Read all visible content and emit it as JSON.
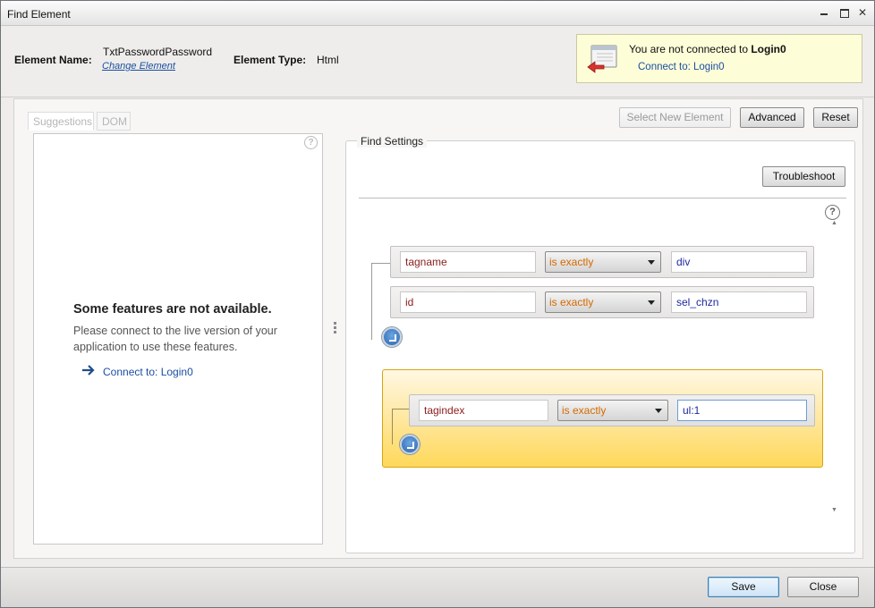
{
  "window": {
    "title": "Find Element"
  },
  "header": {
    "element_name_label": "Element Name:",
    "element_name_value": "TxtPasswordPassword",
    "change_element_link": "Change Element",
    "element_type_label": "Element Type:",
    "element_type_value": "Html"
  },
  "notice": {
    "message_prefix": "You are not connected to",
    "message_target": "Login0",
    "connect_link": "Connect to: Login0"
  },
  "left_panel": {
    "tabs": [
      "Suggestions",
      "DOM"
    ],
    "help": "?",
    "unavailable_title": "Some features are not available.",
    "unavailable_body": "Please connect to the live version of your application to use these features.",
    "connect_link": "Connect to: Login0"
  },
  "toolbar": {
    "select_new_element": "Select New Element",
    "advanced": "Advanced",
    "reset": "Reset"
  },
  "find_settings": {
    "legend": "Find Settings",
    "troubleshoot": "Troubleshoot",
    "help": "?",
    "rows": [
      {
        "attribute": "tagname",
        "operator": "is exactly",
        "value": "div"
      },
      {
        "attribute": "id",
        "operator": "is exactly",
        "value": "sel_chzn"
      }
    ],
    "group_rows": [
      {
        "attribute": "tagindex",
        "operator": "is exactly",
        "value": "ul:1"
      }
    ]
  },
  "footer": {
    "save": "Save",
    "close": "Close"
  },
  "colors": {
    "link": "#1a4fa3",
    "operator": "#d46a00",
    "attribute": "#8a1c1c",
    "value": "#1d2a9e",
    "group_highlight": "#ffd85a",
    "notice_bg": "#fdfdd8"
  }
}
